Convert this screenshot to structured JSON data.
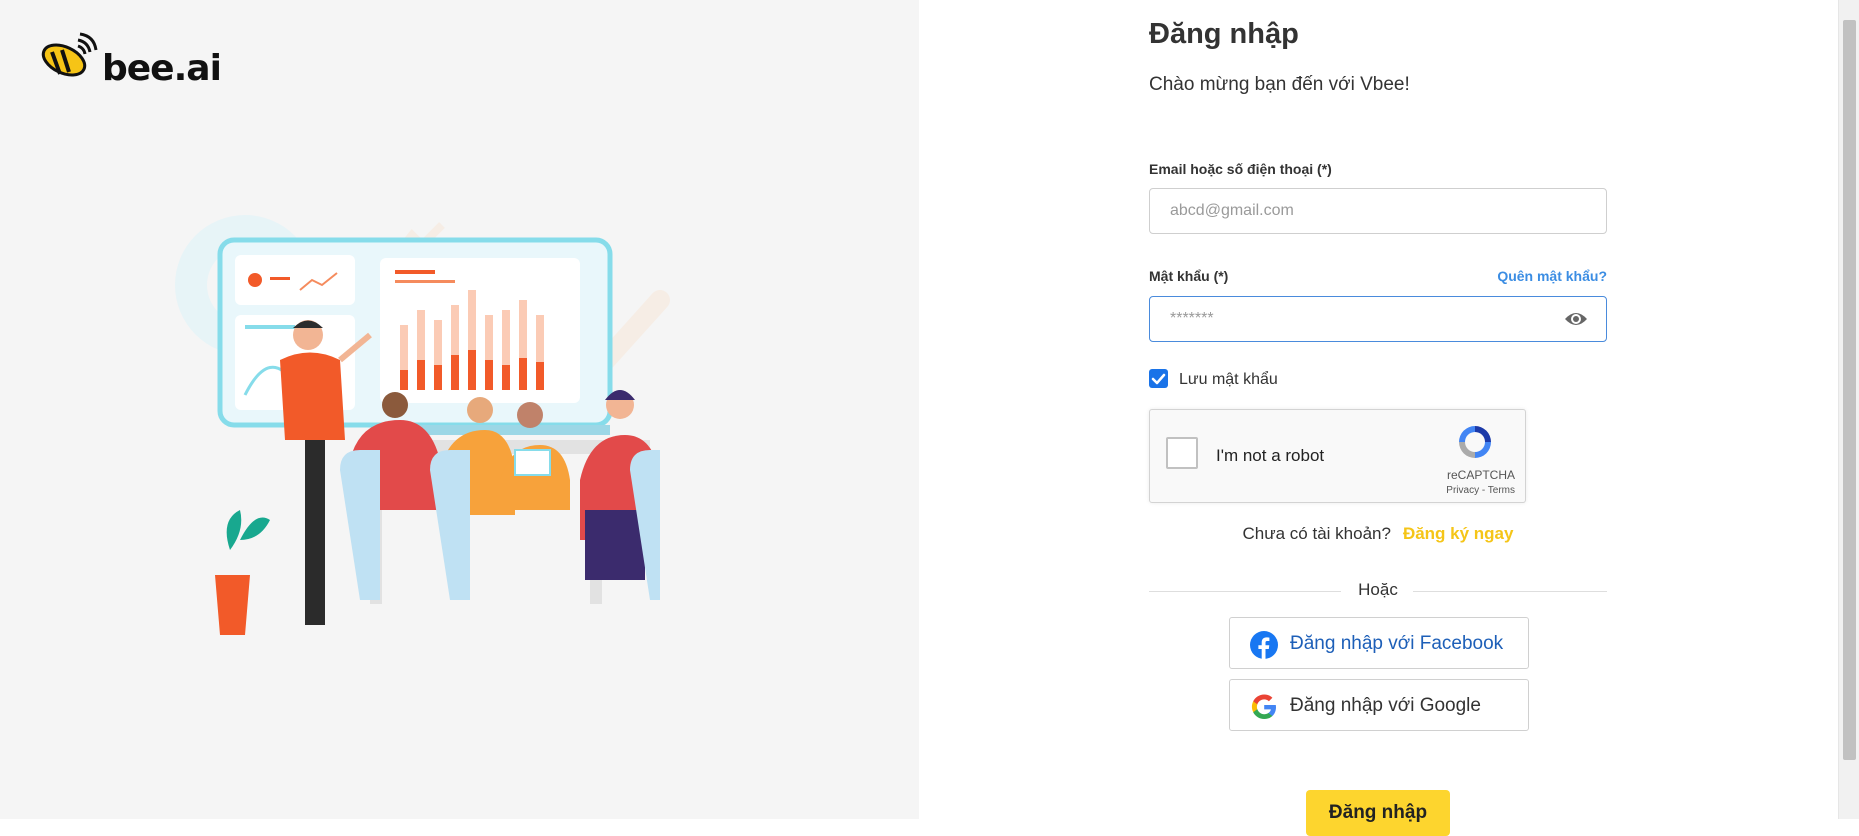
{
  "brand": {
    "logo_text": "bee.ai"
  },
  "login": {
    "title": "Đăng nhập",
    "subtitle": "Chào mừng bạn đến với Vbee!",
    "email_label": "Email hoặc số điện thoại (*)",
    "email_placeholder": "abcd@gmail.com",
    "email_value": "",
    "password_label": "Mật khẩu (*)",
    "forgot_password": "Quên mật khẩu?",
    "password_placeholder": "*******",
    "password_value": "",
    "remember_label": "Lưu mật khẩu",
    "remember_checked": true,
    "no_account": "Chưa có tài khoản?",
    "signup_link": "Đăng ký ngay",
    "or_text": "Hoặc",
    "facebook_button": "Đăng nhập với Facebook",
    "google_button": "Đăng nhập với Google",
    "submit_button": "Đăng nhập"
  },
  "recaptcha": {
    "label": "I'm not a robot",
    "brand": "reCAPTCHA",
    "links": "Privacy - Terms"
  },
  "colors": {
    "accent_yellow": "#fdd52e",
    "link_blue": "#3b8de3",
    "signup_yellow": "#f5c518",
    "facebook_blue": "#1d5fb8",
    "checkbox_blue": "#1a73e8"
  },
  "icons": [
    "bee-logo-icon",
    "eye-icon",
    "check-icon",
    "recaptcha-icon",
    "facebook-icon",
    "google-icon"
  ]
}
